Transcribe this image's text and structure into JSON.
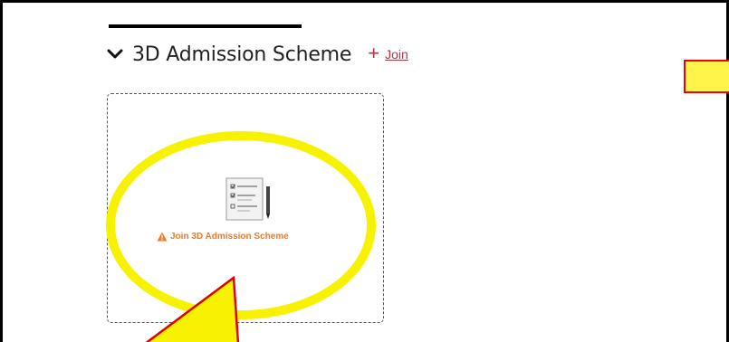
{
  "section": {
    "title": "3D Admission Scheme",
    "chevron_icon": "chevron-down-icon",
    "join_icon": "plus-icon",
    "join_label": "Join"
  },
  "card": {
    "icon": "form-checklist-icon",
    "warning_icon": "warning-icon",
    "label": "Join 3D Admission Scheme"
  },
  "colors": {
    "join_link": "#a23b4a",
    "card_label": "#f07a22",
    "highlight": "#f7f200",
    "callout_border": "#e00000"
  }
}
